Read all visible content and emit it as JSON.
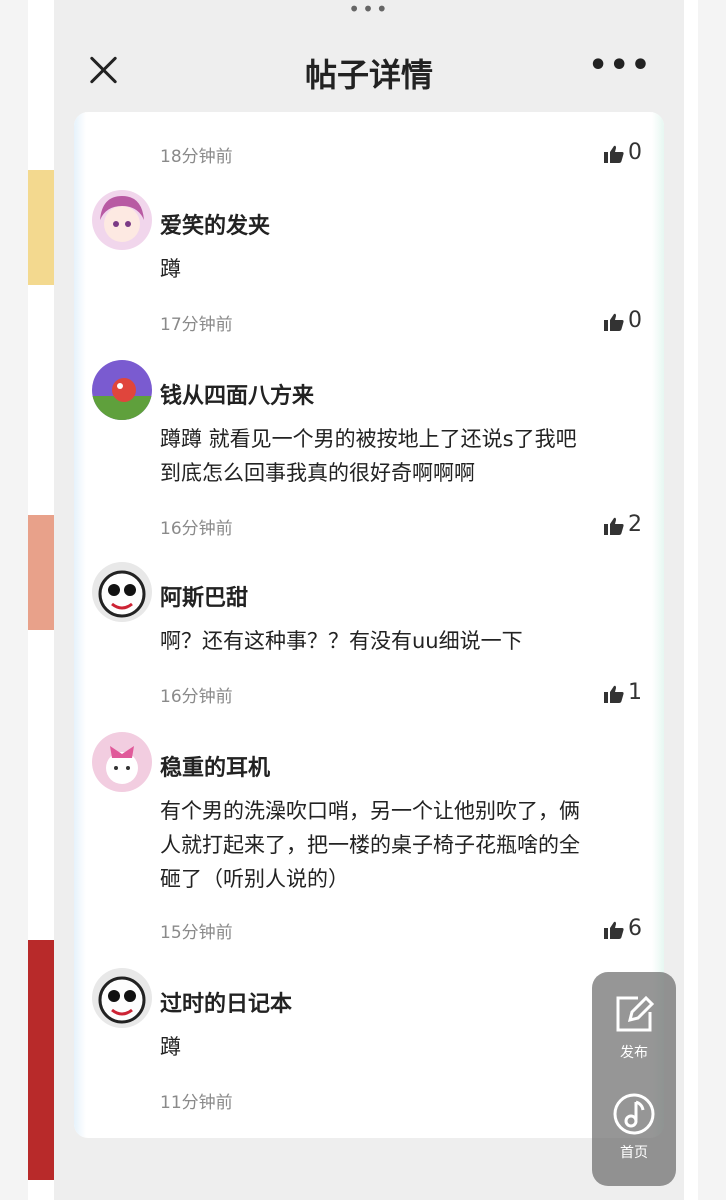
{
  "header": {
    "title": "帖子详情"
  },
  "top_item": {
    "time": "18分钟前",
    "likes": "0"
  },
  "comments": [
    {
      "name": "爱笑的发夹",
      "text": "蹲",
      "time": "17分钟前",
      "likes": "0"
    },
    {
      "name": "钱从四面八方来",
      "text_lines": [
        "蹲蹲 就看见一个男的被按地上了还说s了我吧",
        "到底怎么回事我真的很好奇啊啊啊"
      ],
      "time": "16分钟前",
      "likes": "2"
    },
    {
      "name": "阿斯巴甜",
      "text": "啊？还有这种事？？有没有uu细说一下",
      "time": "16分钟前",
      "likes": "1"
    },
    {
      "name": "稳重的耳机",
      "text_lines": [
        "有个男的洗澡吹口哨，另一个让他别吹了，俩",
        "人就打起来了，把一楼的桌子椅子花瓶啥的全",
        "砸了（听别人说的）"
      ],
      "time": "15分钟前",
      "likes": "6"
    },
    {
      "name": "过时的日记本",
      "text": "蹲",
      "time": "11分钟前",
      "likes": ""
    }
  ],
  "fab": {
    "publish_label": "发布",
    "home_label": "首页"
  },
  "icons": {
    "close": "close-icon",
    "more": "more-icon",
    "thumb": "thumbs-up-icon",
    "publish": "edit-icon",
    "home": "music-note-icon"
  },
  "colors": {
    "accent_fab": "#6e6e6e",
    "text": "#222222",
    "muted": "#8a8a8a"
  }
}
